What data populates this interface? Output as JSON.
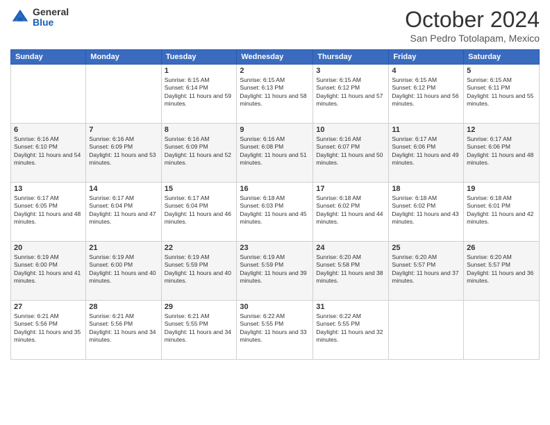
{
  "logo": {
    "general": "General",
    "blue": "Blue"
  },
  "header": {
    "title": "October 2024",
    "location": "San Pedro Totolapam, Mexico"
  },
  "days_of_week": [
    "Sunday",
    "Monday",
    "Tuesday",
    "Wednesday",
    "Thursday",
    "Friday",
    "Saturday"
  ],
  "weeks": [
    [
      {
        "day": "",
        "sunrise": "",
        "sunset": "",
        "daylight": ""
      },
      {
        "day": "",
        "sunrise": "",
        "sunset": "",
        "daylight": ""
      },
      {
        "day": "1",
        "sunrise": "Sunrise: 6:15 AM",
        "sunset": "Sunset: 6:14 PM",
        "daylight": "Daylight: 11 hours and 59 minutes."
      },
      {
        "day": "2",
        "sunrise": "Sunrise: 6:15 AM",
        "sunset": "Sunset: 6:13 PM",
        "daylight": "Daylight: 11 hours and 58 minutes."
      },
      {
        "day": "3",
        "sunrise": "Sunrise: 6:15 AM",
        "sunset": "Sunset: 6:12 PM",
        "daylight": "Daylight: 11 hours and 57 minutes."
      },
      {
        "day": "4",
        "sunrise": "Sunrise: 6:15 AM",
        "sunset": "Sunset: 6:12 PM",
        "daylight": "Daylight: 11 hours and 56 minutes."
      },
      {
        "day": "5",
        "sunrise": "Sunrise: 6:15 AM",
        "sunset": "Sunset: 6:11 PM",
        "daylight": "Daylight: 11 hours and 55 minutes."
      }
    ],
    [
      {
        "day": "6",
        "sunrise": "Sunrise: 6:16 AM",
        "sunset": "Sunset: 6:10 PM",
        "daylight": "Daylight: 11 hours and 54 minutes."
      },
      {
        "day": "7",
        "sunrise": "Sunrise: 6:16 AM",
        "sunset": "Sunset: 6:09 PM",
        "daylight": "Daylight: 11 hours and 53 minutes."
      },
      {
        "day": "8",
        "sunrise": "Sunrise: 6:16 AM",
        "sunset": "Sunset: 6:09 PM",
        "daylight": "Daylight: 11 hours and 52 minutes."
      },
      {
        "day": "9",
        "sunrise": "Sunrise: 6:16 AM",
        "sunset": "Sunset: 6:08 PM",
        "daylight": "Daylight: 11 hours and 51 minutes."
      },
      {
        "day": "10",
        "sunrise": "Sunrise: 6:16 AM",
        "sunset": "Sunset: 6:07 PM",
        "daylight": "Daylight: 11 hours and 50 minutes."
      },
      {
        "day": "11",
        "sunrise": "Sunrise: 6:17 AM",
        "sunset": "Sunset: 6:06 PM",
        "daylight": "Daylight: 11 hours and 49 minutes."
      },
      {
        "day": "12",
        "sunrise": "Sunrise: 6:17 AM",
        "sunset": "Sunset: 6:06 PM",
        "daylight": "Daylight: 11 hours and 48 minutes."
      }
    ],
    [
      {
        "day": "13",
        "sunrise": "Sunrise: 6:17 AM",
        "sunset": "Sunset: 6:05 PM",
        "daylight": "Daylight: 11 hours and 48 minutes."
      },
      {
        "day": "14",
        "sunrise": "Sunrise: 6:17 AM",
        "sunset": "Sunset: 6:04 PM",
        "daylight": "Daylight: 11 hours and 47 minutes."
      },
      {
        "day": "15",
        "sunrise": "Sunrise: 6:17 AM",
        "sunset": "Sunset: 6:04 PM",
        "daylight": "Daylight: 11 hours and 46 minutes."
      },
      {
        "day": "16",
        "sunrise": "Sunrise: 6:18 AM",
        "sunset": "Sunset: 6:03 PM",
        "daylight": "Daylight: 11 hours and 45 minutes."
      },
      {
        "day": "17",
        "sunrise": "Sunrise: 6:18 AM",
        "sunset": "Sunset: 6:02 PM",
        "daylight": "Daylight: 11 hours and 44 minutes."
      },
      {
        "day": "18",
        "sunrise": "Sunrise: 6:18 AM",
        "sunset": "Sunset: 6:02 PM",
        "daylight": "Daylight: 11 hours and 43 minutes."
      },
      {
        "day": "19",
        "sunrise": "Sunrise: 6:18 AM",
        "sunset": "Sunset: 6:01 PM",
        "daylight": "Daylight: 11 hours and 42 minutes."
      }
    ],
    [
      {
        "day": "20",
        "sunrise": "Sunrise: 6:19 AM",
        "sunset": "Sunset: 6:00 PM",
        "daylight": "Daylight: 11 hours and 41 minutes."
      },
      {
        "day": "21",
        "sunrise": "Sunrise: 6:19 AM",
        "sunset": "Sunset: 6:00 PM",
        "daylight": "Daylight: 11 hours and 40 minutes."
      },
      {
        "day": "22",
        "sunrise": "Sunrise: 6:19 AM",
        "sunset": "Sunset: 5:59 PM",
        "daylight": "Daylight: 11 hours and 40 minutes."
      },
      {
        "day": "23",
        "sunrise": "Sunrise: 6:19 AM",
        "sunset": "Sunset: 5:59 PM",
        "daylight": "Daylight: 11 hours and 39 minutes."
      },
      {
        "day": "24",
        "sunrise": "Sunrise: 6:20 AM",
        "sunset": "Sunset: 5:58 PM",
        "daylight": "Daylight: 11 hours and 38 minutes."
      },
      {
        "day": "25",
        "sunrise": "Sunrise: 6:20 AM",
        "sunset": "Sunset: 5:57 PM",
        "daylight": "Daylight: 11 hours and 37 minutes."
      },
      {
        "day": "26",
        "sunrise": "Sunrise: 6:20 AM",
        "sunset": "Sunset: 5:57 PM",
        "daylight": "Daylight: 11 hours and 36 minutes."
      }
    ],
    [
      {
        "day": "27",
        "sunrise": "Sunrise: 6:21 AM",
        "sunset": "Sunset: 5:56 PM",
        "daylight": "Daylight: 11 hours and 35 minutes."
      },
      {
        "day": "28",
        "sunrise": "Sunrise: 6:21 AM",
        "sunset": "Sunset: 5:56 PM",
        "daylight": "Daylight: 11 hours and 34 minutes."
      },
      {
        "day": "29",
        "sunrise": "Sunrise: 6:21 AM",
        "sunset": "Sunset: 5:55 PM",
        "daylight": "Daylight: 11 hours and 34 minutes."
      },
      {
        "day": "30",
        "sunrise": "Sunrise: 6:22 AM",
        "sunset": "Sunset: 5:55 PM",
        "daylight": "Daylight: 11 hours and 33 minutes."
      },
      {
        "day": "31",
        "sunrise": "Sunrise: 6:22 AM",
        "sunset": "Sunset: 5:55 PM",
        "daylight": "Daylight: 11 hours and 32 minutes."
      },
      {
        "day": "",
        "sunrise": "",
        "sunset": "",
        "daylight": ""
      },
      {
        "day": "",
        "sunrise": "",
        "sunset": "",
        "daylight": ""
      }
    ]
  ]
}
